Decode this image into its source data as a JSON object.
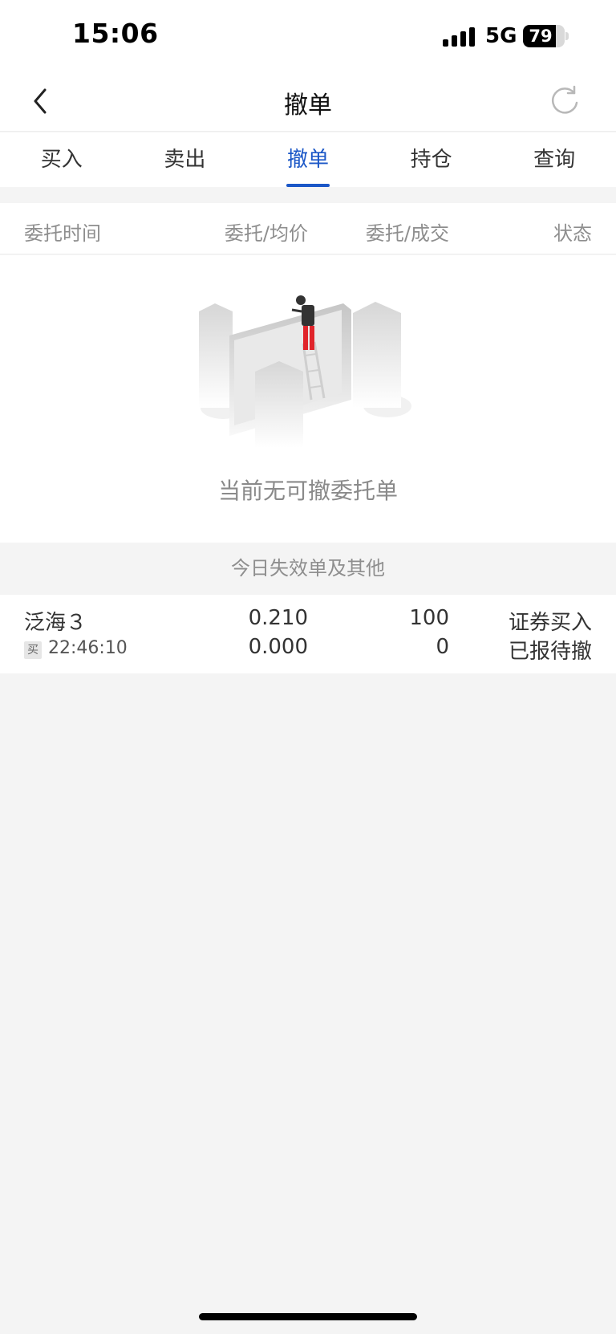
{
  "status_bar": {
    "time": "15:06",
    "network": "5G",
    "battery": "79",
    "battery_level": 0.79,
    "signal_bars": 4
  },
  "nav": {
    "title": "撤单",
    "back_icon": "chevron-left-icon",
    "refresh_icon": "refresh-icon"
  },
  "tabs": [
    {
      "label": "买入",
      "active": false
    },
    {
      "label": "卖出",
      "active": false
    },
    {
      "label": "撤单",
      "active": true
    },
    {
      "label": "持仓",
      "active": false
    },
    {
      "label": "查询",
      "active": false
    }
  ],
  "table": {
    "headers": {
      "time": "委托时间",
      "price": "委托/均价",
      "qty": "委托/成交",
      "status": "状态"
    }
  },
  "empty": {
    "illustration_icon": "empty-state-illustration",
    "message": "当前无可撤委托单"
  },
  "section": {
    "title": "今日失效单及其他"
  },
  "orders": [
    {
      "name": "泛海３",
      "side_badge": "买",
      "time": "22:46:10",
      "price": "0.210",
      "avg_price": "0.000",
      "qty": "100",
      "filled": "0",
      "type": "证券买入",
      "status": "已报待撤"
    }
  ],
  "colors": {
    "accent": "#1b57c7",
    "background": "#f4f4f4",
    "panel": "#ffffff",
    "muted_text": "#8e8e8e"
  }
}
